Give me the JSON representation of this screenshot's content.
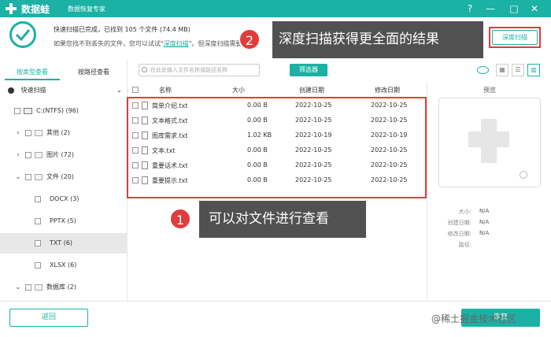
{
  "app": {
    "name": "数据蛙",
    "subtitle": "数据恢复专家",
    "window_controls": [
      "?",
      "—",
      "□",
      "✕"
    ]
  },
  "status": {
    "line1": "快速扫描已完成，已找到 105 个文件 (74.4 MB)",
    "line2_prefix": "如果您找不到丢失的文件，您可以试试\"",
    "deep_scan_link": "深度扫描",
    "line2_suffix": "\"。但深度扫描需要更",
    "deep_scan_button": "深度扫描"
  },
  "callouts": {
    "one_number": "1",
    "one_text": "可以对文件进行查看",
    "two_number": "2",
    "two_text": "深度扫描获得更全面的结果"
  },
  "sidebar": {
    "tabs": [
      "按类型查看",
      "按路径查看"
    ],
    "active_tab": 0,
    "quick_scan": "快速扫描",
    "tree": [
      {
        "label": "C:(NTFS) (96)",
        "level": 0,
        "arrow": "",
        "icon": "drive",
        "selected": false
      },
      {
        "label": "其他 (2)",
        "level": 1,
        "arrow": "›",
        "icon": "folder",
        "selected": false
      },
      {
        "label": "图片 (72)",
        "level": 1,
        "arrow": "›",
        "icon": "image",
        "selected": false
      },
      {
        "label": "文件 (20)",
        "level": 1,
        "arrow": "⌄",
        "icon": "doc",
        "selected": false
      },
      {
        "label": "DOCX (3)",
        "level": 2,
        "arrow": "",
        "icon": "",
        "selected": false
      },
      {
        "label": "PPTX (5)",
        "level": 2,
        "arrow": "",
        "icon": "",
        "selected": false
      },
      {
        "label": "TXT (6)",
        "level": 2,
        "arrow": "",
        "icon": "",
        "selected": true
      },
      {
        "label": "XLSX (6)",
        "level": 2,
        "arrow": "",
        "icon": "",
        "selected": false
      },
      {
        "label": "数据库 (2)",
        "level": 1,
        "arrow": "⌄",
        "icon": "db",
        "selected": false
      }
    ]
  },
  "toolbar": {
    "search_placeholder": "在此处输入文件名称或路径名称",
    "filter_button": "筛选器"
  },
  "table": {
    "headers": {
      "name": "名称",
      "size": "大小",
      "created": "创建日期",
      "modified": "修改日期"
    },
    "rows": [
      {
        "name": "简单介绍.txt",
        "size": "0.00  B",
        "created": "2022-10-25",
        "modified": "2022-10-25"
      },
      {
        "name": "文本格式.txt",
        "size": "0.00  B",
        "created": "2022-10-25",
        "modified": "2022-10-25"
      },
      {
        "name": "图库需求.txt",
        "size": "1.02 KB",
        "created": "2022-10-19",
        "modified": "2022-10-19"
      },
      {
        "name": "文本.txt",
        "size": "0.00  B",
        "created": "2022-10-25",
        "modified": "2022-10-25"
      },
      {
        "name": "重要话术.txt",
        "size": "0.00  B",
        "created": "2022-10-25",
        "modified": "2022-10-25"
      },
      {
        "name": "重要提示.txt",
        "size": "0.00  B",
        "created": "2022-10-25",
        "modified": "2022-10-25"
      }
    ]
  },
  "preview": {
    "title": "预览",
    "fields": [
      {
        "label": "大小:",
        "value": "N/A"
      },
      {
        "label": "创建日期:",
        "value": "N/A"
      },
      {
        "label": "修改日期:",
        "value": "N/A"
      },
      {
        "label": "路径:",
        "value": ""
      }
    ]
  },
  "bottom": {
    "back_button": "返回",
    "recover_button": "恢复",
    "watermark": "@稀土掘金技术社区"
  },
  "colors": {
    "accent": "#1bb1a4",
    "highlight": "#e23b3b",
    "callout_bg": "#515151"
  }
}
